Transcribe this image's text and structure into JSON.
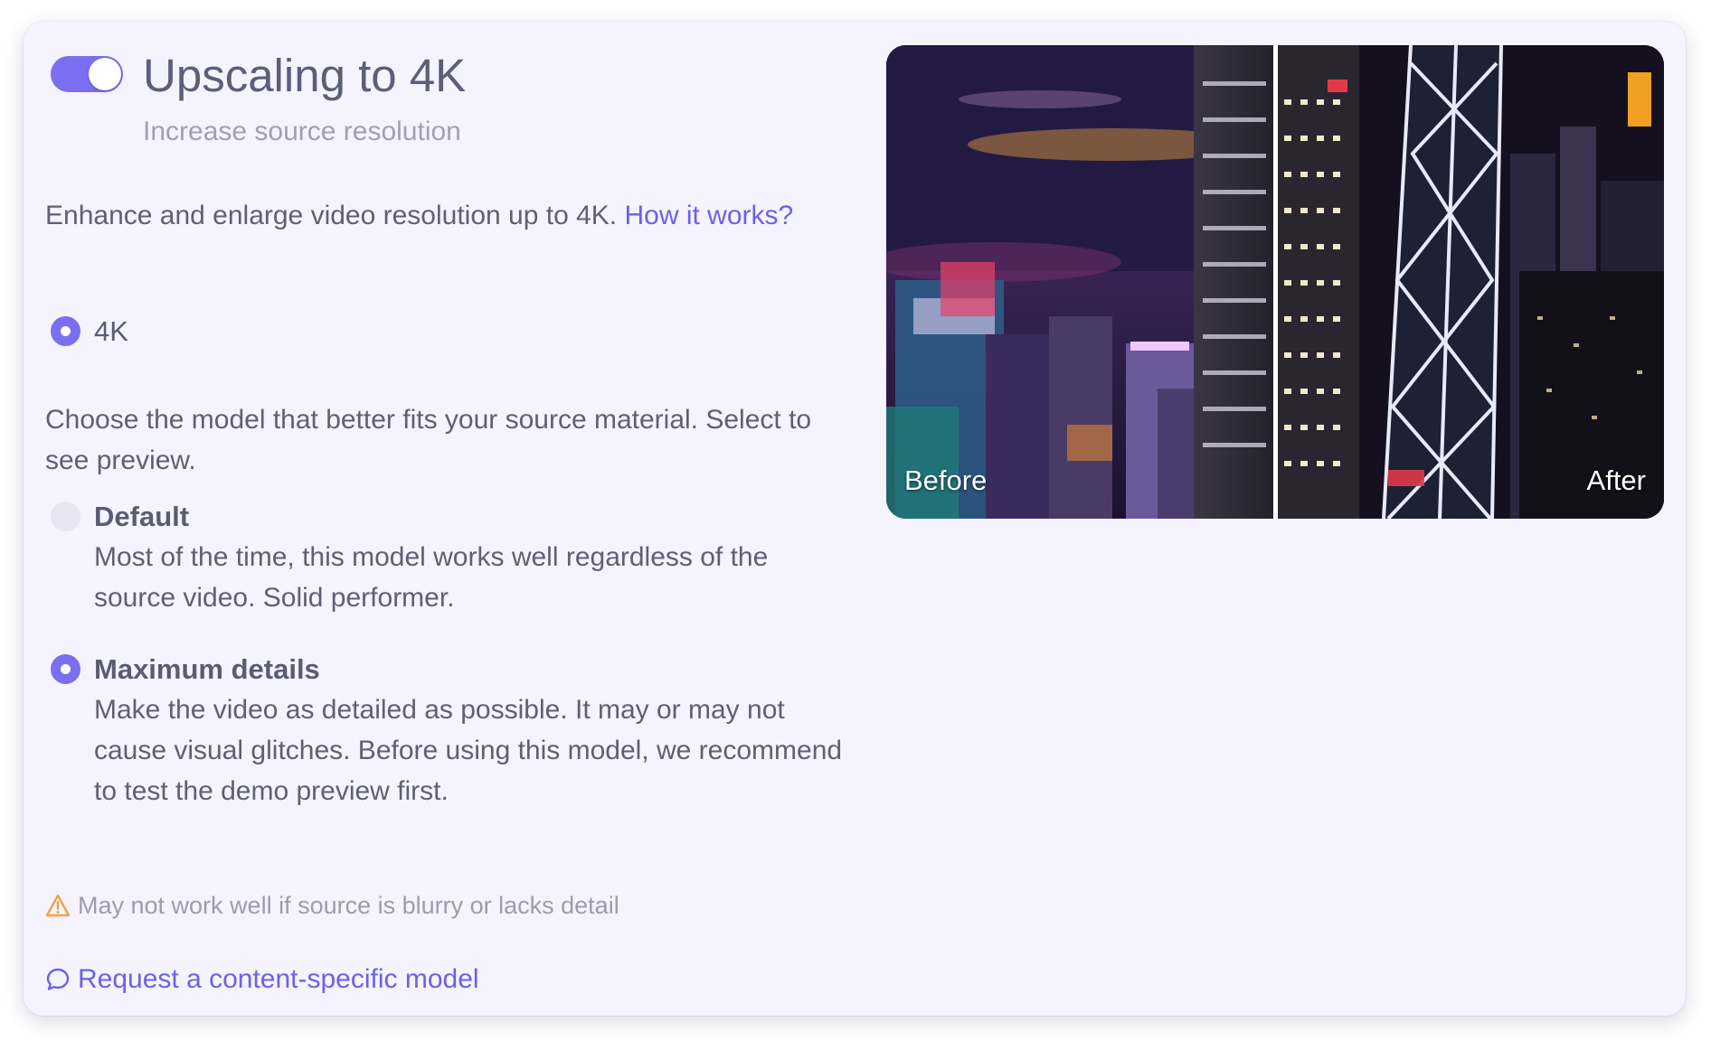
{
  "header": {
    "toggle_on": true,
    "title": "Upscaling to 4K",
    "subtitle": "Increase source resolution"
  },
  "intro": {
    "text": "Enhance and enlarge video resolution up to 4K. ",
    "link": "How it works?"
  },
  "resolution": {
    "option_label": "4K",
    "selected": true
  },
  "model_help": "Choose the model that better fits your source material. Select to see preview.",
  "models": [
    {
      "label": "Default",
      "description": "Most of the time, this model works well regardless of the source video. Solid performer.",
      "selected": false
    },
    {
      "label": "Maximum details",
      "description": "Make the video as detailed as possible. It may or may not cause visual glitches. Before using this model, we recommend to test the demo preview first.",
      "selected": true
    }
  ],
  "warning": "May not work well if source is blurry or lacks detail",
  "request_link": "Request a content-specific model",
  "preview": {
    "before_label": "Before",
    "after_label": "After",
    "split_fraction": 0.5
  },
  "colors": {
    "accent": "#7a6ff0",
    "link": "#6b62e6",
    "warning_icon": "#f0a447",
    "card_bg": "#f5f3fd"
  }
}
